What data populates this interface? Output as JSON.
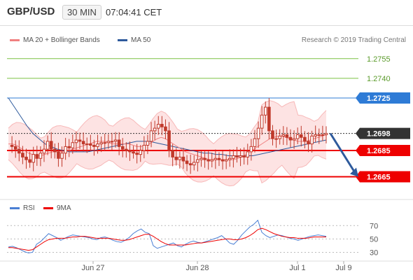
{
  "header": {
    "pair": "GBP/USD",
    "interval": "30 MIN",
    "time": "07:04:41 CET"
  },
  "legend": {
    "ma20_label": "MA 20 + Bollinger Bands",
    "ma50_label": "MA 50",
    "copyright": "Research © 2019 Trading Central"
  },
  "rsi_legend": {
    "rsi_label": "RSI",
    "ma9_label": "9MA"
  },
  "colors": {
    "ma20": "#f08080",
    "bollinger_fill": "#fde0e0",
    "ma50": "#2e5a9c",
    "support_line": "#ee0000",
    "target_line": "#7ac143",
    "pivot_line": "#2e7bd6",
    "current_price_tag": "#333333",
    "candle": "#c0392b",
    "rsi_line": "#4a7fd4",
    "rsi_ma": "#ee0000",
    "arrow": "#2e5a9c"
  },
  "chart_data": [
    {
      "type": "candlestick",
      "title": "",
      "x_labels": [
        "Jun 27",
        "Jun 28",
        "Jul 1",
        "Jul 9"
      ],
      "price_levels": [
        {
          "value": "1.2755",
          "kind": "target"
        },
        {
          "value": "1.2740",
          "kind": "target"
        },
        {
          "value": "1.2725",
          "kind": "pivot"
        },
        {
          "value": "1.2698",
          "kind": "current"
        },
        {
          "value": "1.2685",
          "kind": "support"
        },
        {
          "value": "1.2665",
          "kind": "support"
        }
      ],
      "ylim": [
        1.2653,
        1.2765
      ],
      "price_series": [
        1.2689,
        1.2688,
        1.2686,
        1.2683,
        1.268,
        1.2678,
        1.2676,
        1.2682,
        1.2679,
        1.2683,
        1.2686,
        1.2692,
        1.2686,
        1.2684,
        1.2679,
        1.2683,
        1.2688,
        1.2687,
        1.2691,
        1.2693,
        1.2692,
        1.269,
        1.269,
        1.2689,
        1.2688,
        1.269,
        1.2691,
        1.2691,
        1.2692,
        1.2692,
        1.2693,
        1.2688,
        1.2686,
        1.2685,
        1.2684,
        1.2683,
        1.2682,
        1.2685,
        1.2689,
        1.2692,
        1.27,
        1.2702,
        1.2705,
        1.2703,
        1.27,
        1.2685,
        1.268,
        1.2678,
        1.268,
        1.2677,
        1.2675,
        1.2674,
        1.2676,
        1.2678,
        1.2679,
        1.2678,
        1.2677,
        1.2678,
        1.2679,
        1.2678,
        1.2677,
        1.2678,
        1.2679,
        1.2681,
        1.268,
        1.2681,
        1.268,
        1.2684,
        1.2688,
        1.2694,
        1.2702,
        1.2712,
        1.2718,
        1.27,
        1.2694,
        1.2694,
        1.2696,
        1.2697,
        1.2695,
        1.2693,
        1.2694,
        1.2697,
        1.2695,
        1.2692,
        1.269,
        1.2696,
        1.2697,
        1.2697,
        1.2697,
        1.2698
      ],
      "series": [
        {
          "name": "MA 20",
          "values": [
            1.269,
            1.269,
            1.2689,
            1.2687,
            1.2685,
            1.2683,
            1.2682,
            1.2681,
            1.2681,
            1.2682,
            1.2683,
            1.2684,
            1.2684,
            1.2684,
            1.2684,
            1.2685,
            1.2686,
            1.2687,
            1.2688,
            1.2689,
            1.269,
            1.2691,
            1.2692,
            1.2692,
            1.2692,
            1.2691,
            1.269,
            1.269,
            1.269,
            1.269,
            1.269,
            1.2689,
            1.2688,
            1.2688,
            1.2689,
            1.269,
            1.2692,
            1.2694,
            1.2695,
            1.2694,
            1.2692,
            1.269,
            1.2688,
            1.2686,
            1.2684,
            1.2683,
            1.2682,
            1.2681,
            1.268,
            1.2679,
            1.2678,
            1.2678,
            1.2678,
            1.2678,
            1.2678,
            1.2678,
            1.2678,
            1.2679,
            1.268,
            1.2682,
            1.2684,
            1.2686,
            1.2688,
            1.269,
            1.2692,
            1.2694,
            1.2695,
            1.2696,
            1.2696,
            1.2695,
            1.2694,
            1.2693,
            1.2692,
            1.2692,
            1.2692,
            1.2693,
            1.2694,
            1.2695,
            1.2696,
            1.2697
          ]
        },
        {
          "name": "MA 50",
          "values": [
            1.2725,
            1.2718,
            1.2711,
            1.2704,
            1.2698,
            1.2694,
            1.269,
            1.2688,
            1.2686,
            1.2685,
            1.2684,
            1.2684,
            1.2684,
            1.2684,
            1.2685,
            1.2686,
            1.2687,
            1.2688,
            1.2689,
            1.269,
            1.2691,
            1.2692,
            1.2692,
            1.2692,
            1.2691,
            1.269,
            1.2689,
            1.2688,
            1.2687,
            1.2686,
            1.2685,
            1.2684,
            1.2683,
            1.2683,
            1.2682,
            1.2682,
            1.2681,
            1.2681,
            1.2681,
            1.2681,
            1.2681,
            1.2682,
            1.2683,
            1.2684,
            1.2685,
            1.2686,
            1.2687,
            1.2688,
            1.2689,
            1.269,
            1.2691,
            1.2692,
            1.2693
          ]
        }
      ],
      "projection": {
        "from": 1.2698,
        "to": 1.2665
      }
    },
    {
      "type": "line",
      "title": "RSI",
      "y_ticks": [
        "70",
        "50",
        "30"
      ],
      "ylim": [
        20,
        85
      ],
      "series": [
        {
          "name": "RSI",
          "values": [
            38,
            39,
            37,
            34,
            31,
            29,
            30,
            42,
            46,
            52,
            58,
            55,
            52,
            48,
            51,
            54,
            56,
            55,
            54,
            53,
            52,
            50,
            49,
            52,
            53,
            51,
            48,
            46,
            45,
            48,
            52,
            58,
            62,
            65,
            60,
            58,
            40,
            36,
            38,
            40,
            42,
            44,
            40,
            38,
            42,
            45,
            47,
            45,
            44,
            46,
            48,
            50,
            52,
            55,
            50,
            44,
            42,
            48,
            56,
            62,
            68,
            72,
            78,
            60,
            55,
            52,
            54,
            56,
            55,
            53,
            51,
            50,
            48,
            50,
            52,
            54,
            55,
            56,
            55,
            54
          ]
        },
        {
          "name": "9MA",
          "values": [
            37,
            37,
            36,
            35,
            34,
            33,
            34,
            38,
            42,
            46,
            49,
            50,
            51,
            51,
            51,
            52,
            53,
            53,
            54,
            54,
            53,
            52,
            51,
            51,
            51,
            51,
            50,
            49,
            48,
            48,
            49,
            51,
            53,
            55,
            57,
            57,
            54,
            50,
            46,
            43,
            41,
            41,
            41,
            41,
            41,
            42,
            43,
            44,
            44,
            45,
            46,
            47,
            48,
            49,
            50,
            50,
            49,
            49,
            50,
            52,
            55,
            59,
            64,
            66,
            64,
            61,
            58,
            56,
            54,
            53,
            52,
            52,
            51,
            51,
            51,
            52,
            53,
            53,
            53,
            53
          ]
        }
      ]
    }
  ]
}
